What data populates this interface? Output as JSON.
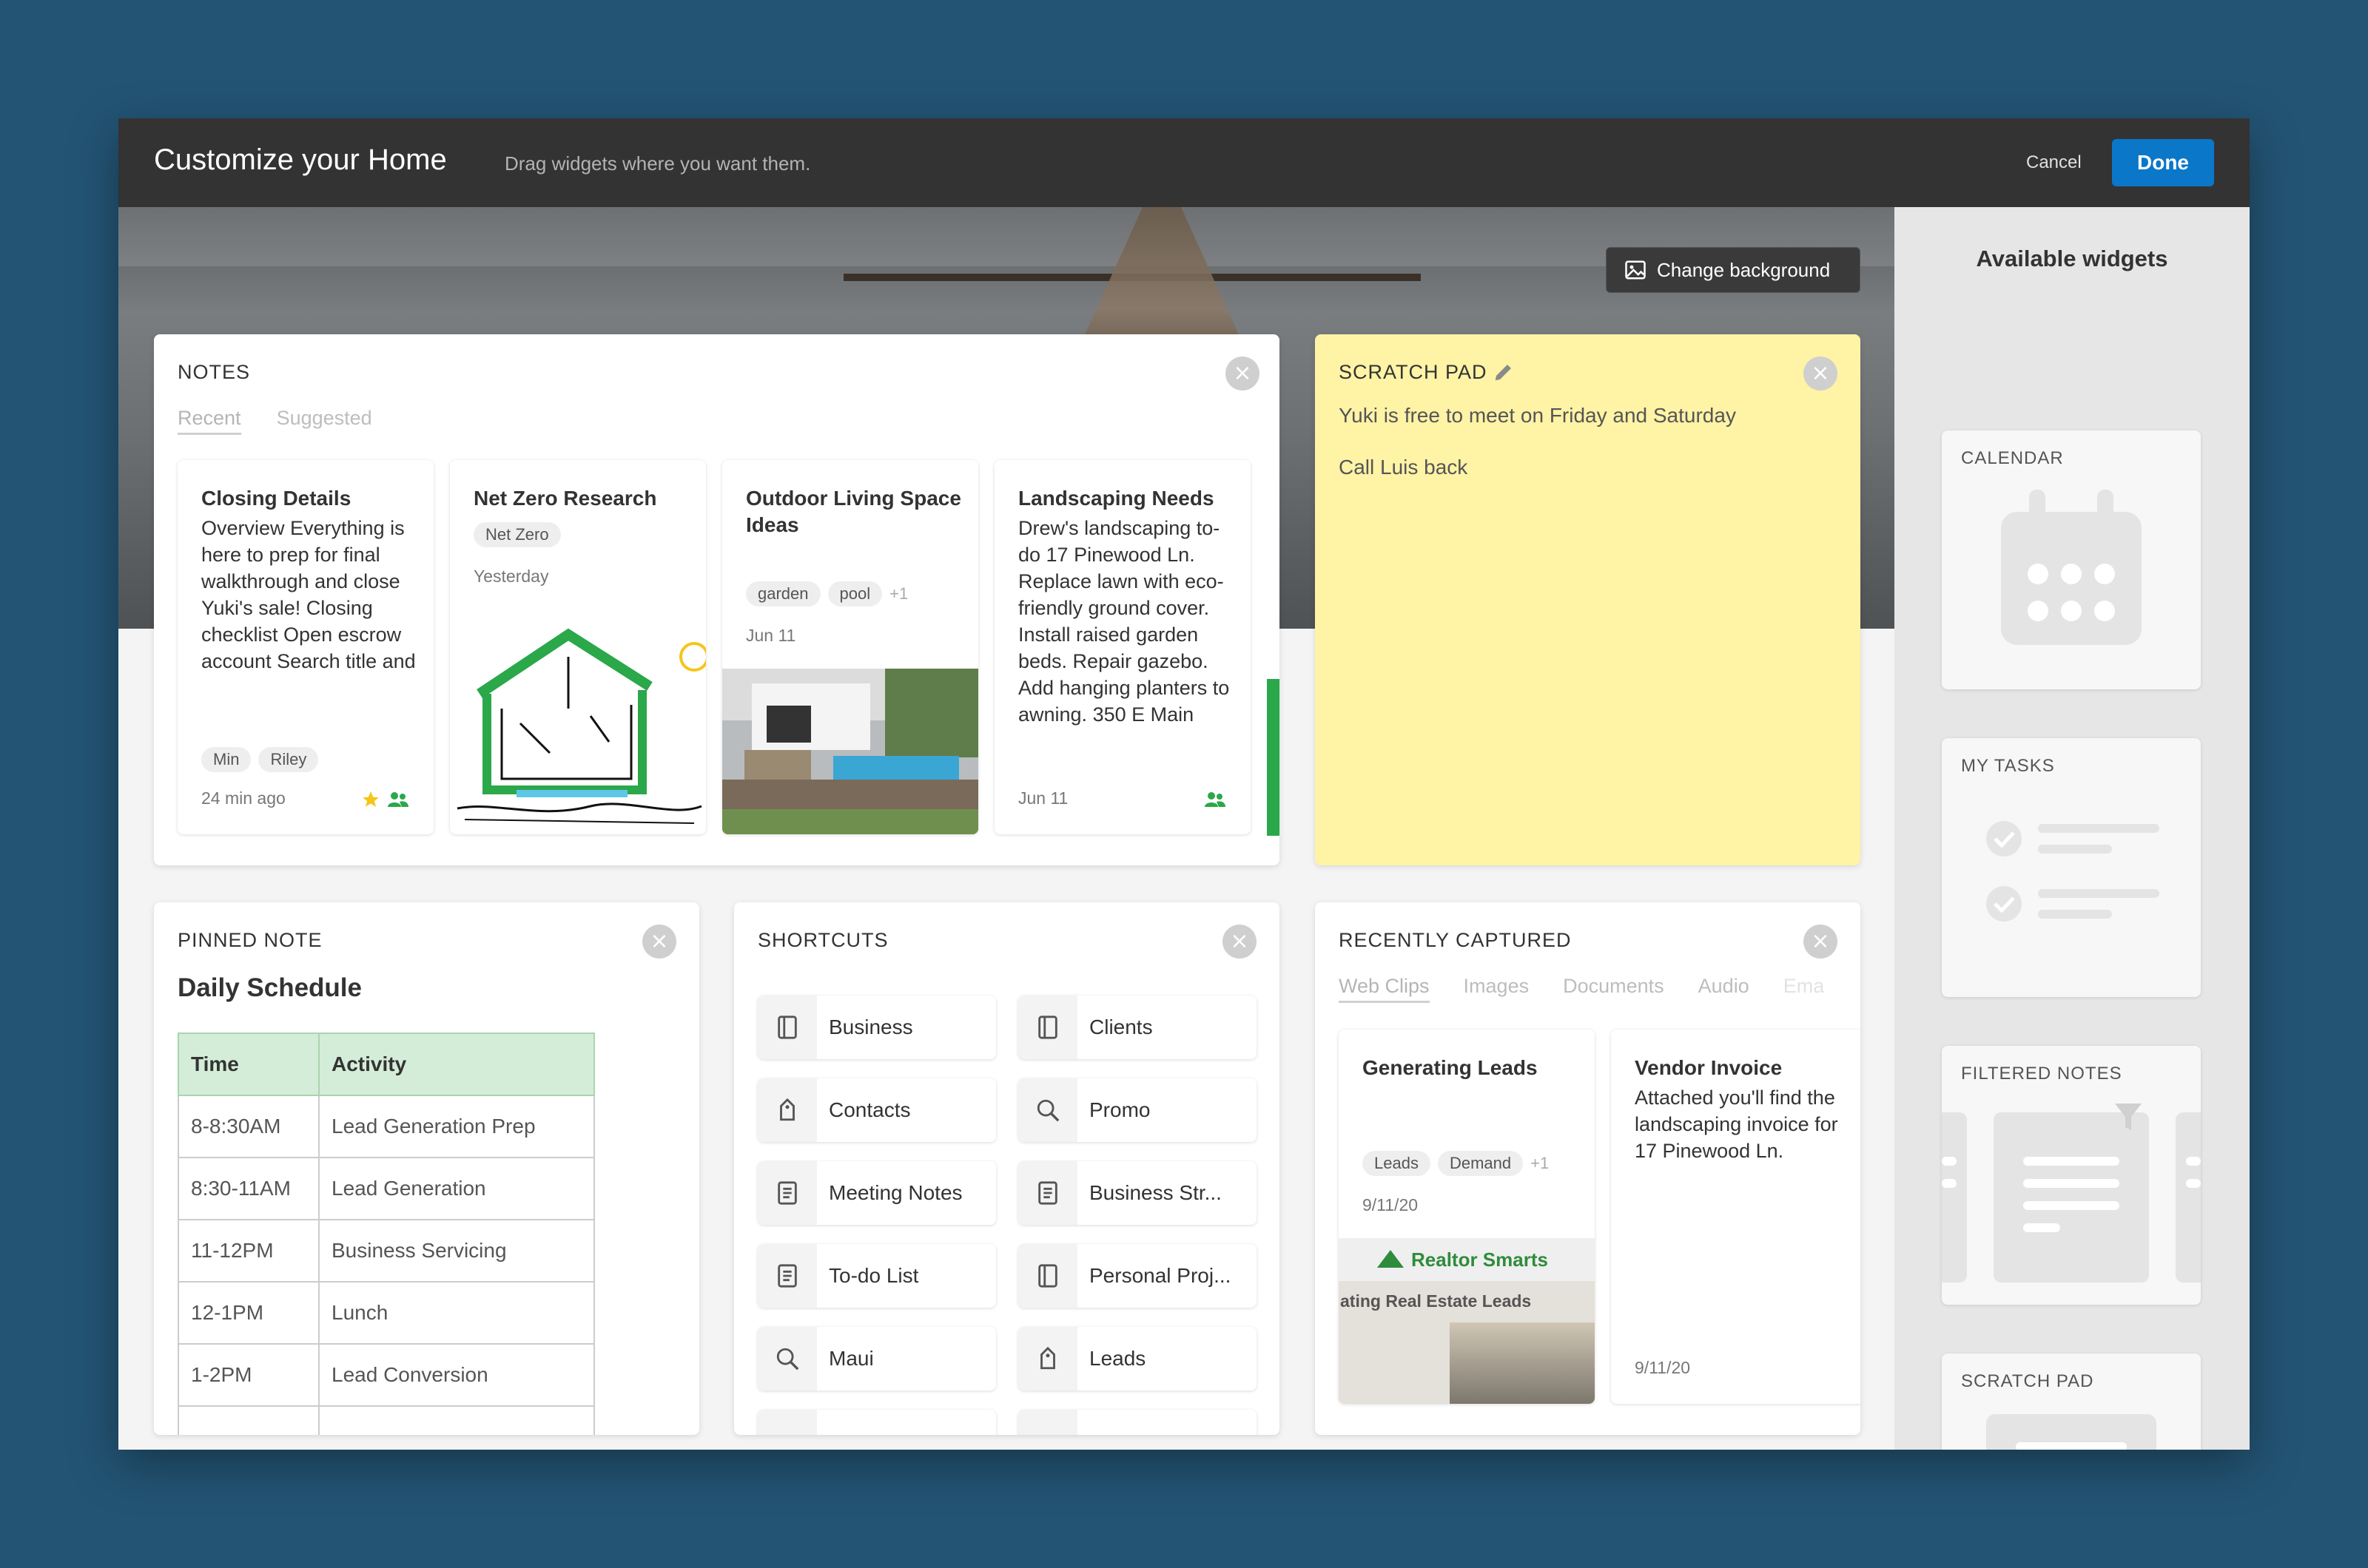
{
  "header": {
    "title": "Customize your Home",
    "subtitle": "Drag widgets where you want them.",
    "cancel": "Cancel",
    "done": "Done"
  },
  "hero": {
    "change_background": "Change background"
  },
  "notes": {
    "title": "NOTES",
    "tabs": [
      "Recent",
      "Suggested"
    ],
    "items": [
      {
        "title": "Closing Details",
        "body": "Overview Everything is here to prep for final walkthrough and close Yuki's sale! Closing checklist Open escrow account Search title and",
        "tags": [
          "Min",
          "Riley"
        ],
        "date": "24 min ago"
      },
      {
        "title": "Net Zero Research",
        "tags": [
          "Net Zero"
        ],
        "date": "Yesterday"
      },
      {
        "title": "Outdoor Living Space Ideas",
        "tags": [
          "garden",
          "pool"
        ],
        "more": "+1",
        "date": "Jun 11"
      },
      {
        "title": "Landscaping Needs",
        "body": "Drew's landscaping to-do 17 Pinewood Ln. Replace lawn with eco-friendly ground cover. Install raised garden beds. Repair gazebo. Add hanging planters to awning. 350 E Main",
        "date": "Jun 11"
      }
    ]
  },
  "scratch": {
    "title": "SCRATCH PAD",
    "lines": [
      "Yuki is free to meet on Friday and Saturday",
      "Call Luis back"
    ]
  },
  "pinned": {
    "title": "PINNED NOTE",
    "note_title": "Daily Schedule",
    "headers": [
      "Time",
      "Activity"
    ],
    "rows": [
      [
        "8-8:30AM",
        "Lead Generation Prep"
      ],
      [
        "8:30-11AM",
        "Lead Generation"
      ],
      [
        "11-12PM",
        "Business Servicing"
      ],
      [
        "12-1PM",
        "Lunch"
      ],
      [
        "1-2PM",
        "Lead Conversion"
      ]
    ]
  },
  "shortcuts": {
    "title": "SHORTCUTS",
    "items": [
      {
        "label": "Business",
        "icon": "notebook-icon"
      },
      {
        "label": "Clients",
        "icon": "notebook-icon"
      },
      {
        "label": "Contacts",
        "icon": "tag-icon"
      },
      {
        "label": "Promo",
        "icon": "search-icon"
      },
      {
        "label": "Meeting Notes",
        "icon": "note-icon"
      },
      {
        "label": "Business Str...",
        "icon": "note-icon"
      },
      {
        "label": "To-do List",
        "icon": "note-icon"
      },
      {
        "label": "Personal Proj...",
        "icon": "notebook-icon"
      },
      {
        "label": "Maui",
        "icon": "search-icon"
      },
      {
        "label": "Leads",
        "icon": "tag-icon"
      }
    ]
  },
  "recent": {
    "title": "RECENTLY CAPTURED",
    "tabs": [
      "Web Clips",
      "Images",
      "Documents",
      "Audio",
      "Ema"
    ],
    "items": [
      {
        "title": "Generating Leads",
        "tags": [
          "Leads",
          "Demand"
        ],
        "more": "+1",
        "date": "9/11/20",
        "clip_brand": "Realtor Smarts",
        "clip_headline": "ating Real Estate Leads"
      },
      {
        "title": "Vendor Invoice",
        "body": "Attached you'll find the landscaping invoice for 17 Pinewood Ln.",
        "date": "9/11/20"
      }
    ]
  },
  "sidebar": {
    "title": "Available widgets",
    "widgets": [
      "CALENDAR",
      "MY TASKS",
      "FILTERED NOTES",
      "SCRATCH PAD"
    ]
  },
  "colors": {
    "accent": "#0a77c9",
    "scratch": "#fff3a6",
    "table_header": "#d4edd8",
    "green": "#2aa84a"
  }
}
